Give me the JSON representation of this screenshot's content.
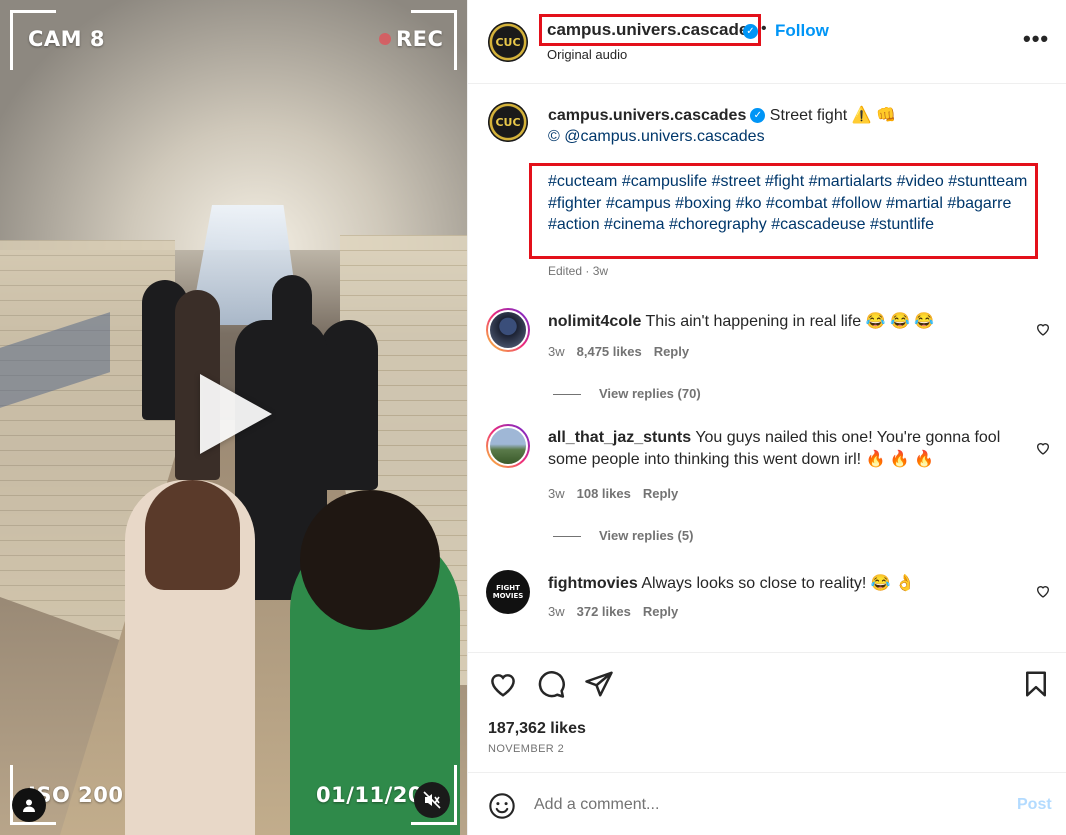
{
  "video": {
    "cam_label": "CAM 8",
    "rec_label": "REC",
    "iso_label": "ISO 200",
    "date_label": "01/11/202",
    "icons": {
      "play": "play-icon",
      "user": "user-tag-icon",
      "mute": "muted-icon"
    }
  },
  "header": {
    "username": "campus.univers.cascades",
    "follow_label": "Follow",
    "subtitle": "Original audio",
    "separator": "•",
    "more_label": "•••"
  },
  "caption": {
    "username": "campus.univers.cascades",
    "text": " Street fight ⚠️ 👊",
    "credit": "© @campus.univers.cascades",
    "hashtags": "#cucteam #campuslife #street #fight #martialarts #video #stuntteam #fighter #campus #boxing #ko #combat #follow #martial #bagarre #action #cinema #choregraphy #cascadeuse #stuntlife",
    "edited": "Edited · 3w"
  },
  "comments": [
    {
      "username": "nolimit4cole",
      "text": " This ain't happening in real life 😂 😂 😂",
      "age": "3w",
      "likes": "8,475 likes",
      "reply": "Reply",
      "view_replies": "View replies (70)"
    },
    {
      "username": "all_that_jaz_stunts",
      "text": " You guys nailed this one! You're gonna fool some people into thinking this went down irl! 🔥 🔥 🔥",
      "age": "3w",
      "likes": "108 likes",
      "reply": "Reply",
      "view_replies": "View replies (5)"
    },
    {
      "username": "fightmovies",
      "text": " Always looks so close to reality! 😂 👌",
      "age": "3w",
      "likes": "372 likes",
      "reply": "Reply"
    }
  ],
  "actions": {
    "likes": "187,362 likes",
    "date": "NOVEMBER 2"
  },
  "add_comment": {
    "placeholder": "Add a comment...",
    "post_label": "Post"
  },
  "colors": {
    "accent": "#0095f6",
    "highlight_box": "#e3101a",
    "hashtag": "#00376b",
    "muted": "#737373"
  }
}
